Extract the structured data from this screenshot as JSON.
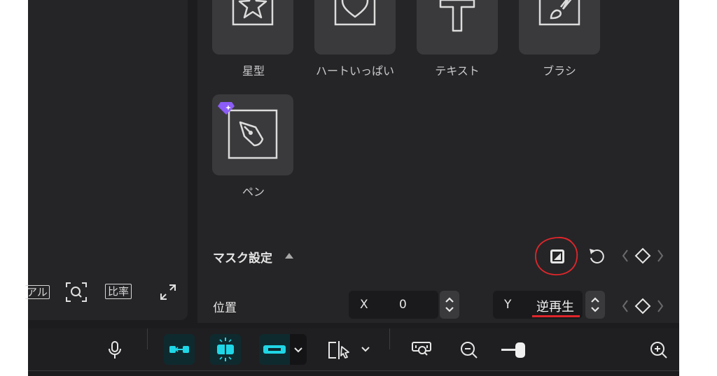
{
  "masks": {
    "items": [
      {
        "label": "星型",
        "icon": "star-icon"
      },
      {
        "label": "ハートいっぱい",
        "icon": "heart-icon"
      },
      {
        "label": "テキスト",
        "icon": "text-t-icon"
      },
      {
        "label": "ブラシ",
        "icon": "brush-icon"
      },
      {
        "label": "ペン",
        "icon": "pen-icon",
        "premium": true
      }
    ]
  },
  "mask_settings": {
    "title": "マスク設定",
    "position_label": "位置",
    "x_label": "X",
    "x_value": "0",
    "y_label": "Y",
    "y_value": "逆再生"
  },
  "player_controls": {
    "left_cut_label": "アル",
    "ratio_label": "比率"
  },
  "colors": {
    "accent": "#1fd6e6",
    "annotation_red": "#e0262b",
    "premium_purple": "#8b5cf6"
  }
}
